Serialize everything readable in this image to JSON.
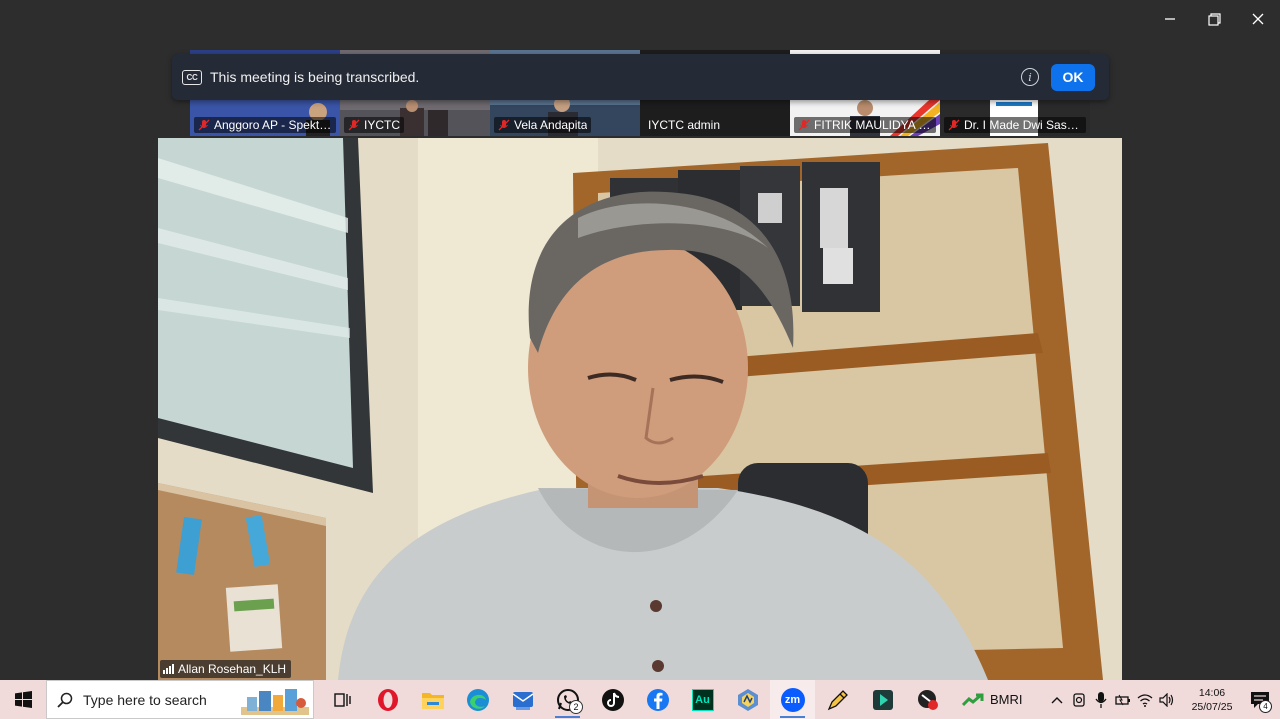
{
  "window": {
    "controls": [
      "minimize",
      "restore",
      "close"
    ]
  },
  "banner": {
    "text": "This meeting is being transcribed.",
    "ok_label": "OK",
    "icon": "closed-caption-icon"
  },
  "gallery": [
    {
      "name": "Anggoro AP - Spektr...",
      "muted": true
    },
    {
      "name": "IYCTC",
      "muted": true
    },
    {
      "name": "Vela Andapita",
      "muted": true
    },
    {
      "name": "IYCTC admin",
      "muted": false
    },
    {
      "name": "FITRIK MAULIDYA NA...",
      "muted": true
    },
    {
      "name": "Dr. I Made Dwi Sastr...",
      "muted": true
    }
  ],
  "main_video": {
    "speaker_name": "Allan Rosehan_KLH"
  },
  "taskbar": {
    "search_placeholder": "Type here to search",
    "apps": [
      {
        "name": "task-view-icon"
      },
      {
        "name": "opera-icon"
      },
      {
        "name": "file-explorer-icon"
      },
      {
        "name": "edge-icon"
      },
      {
        "name": "mail-app-icon"
      },
      {
        "name": "whatsapp-icon",
        "badge": "2"
      },
      {
        "name": "tiktok-icon"
      },
      {
        "name": "facebook-icon"
      },
      {
        "name": "audition-icon",
        "label": "Au"
      },
      {
        "name": "vpn-app-icon"
      },
      {
        "name": "zoom-icon",
        "label": "zm"
      },
      {
        "name": "pen-tool-icon"
      },
      {
        "name": "capcut-icon"
      },
      {
        "name": "recorder-icon"
      }
    ],
    "stock": {
      "symbol": "BMRI",
      "color": "#2e9e3e"
    },
    "clock": {
      "time": "14:06",
      "date": "25/07/25"
    },
    "notifications": "4"
  },
  "colors": {
    "accent": "#0e72ed",
    "banner_bg": "#242a36",
    "mute_red": "#e02828",
    "taskbar_bg": "#f0dada"
  }
}
